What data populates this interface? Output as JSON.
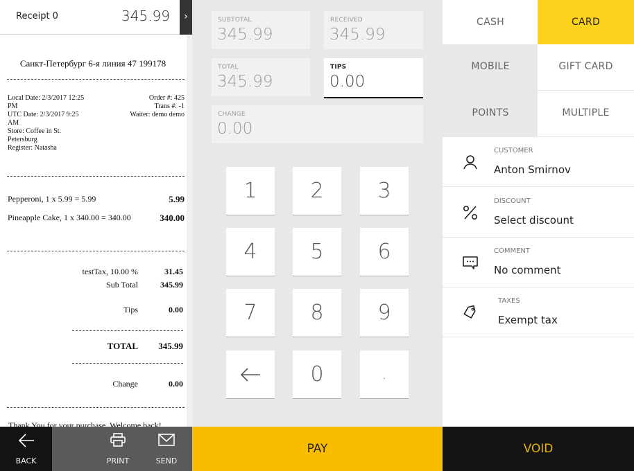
{
  "receipt_header": {
    "label": "Receipt  0",
    "amount": "345.99",
    "expand_icon": "chevron-right"
  },
  "receipt": {
    "store_address": "Санкт-Петербург 6-я линия 47 199178",
    "meta_left": [
      "Local Date: 2/3/2017 12:25",
      "PM",
      "UTC Date: 2/3/2017 9:25",
      "AM",
      "Store: Coffee in St.",
      "Petersburg",
      "Register: Natasha"
    ],
    "meta_right": [
      "Order #: 425",
      "Trans #: -1",
      "Waiter: demo demo"
    ],
    "items": [
      {
        "name": "Pepperoni, 1 x 5.99 = 5.99",
        "amount": "5.99"
      },
      {
        "name": "Pineapple Cake, 1 x 340.00 = 340.00",
        "amount": "340.00"
      }
    ],
    "tax": {
      "label": "testTax, 10.00 %",
      "value": "31.45"
    },
    "subtotal": {
      "label": "Sub Total",
      "value": "345.99"
    },
    "tips": {
      "label": "Tips",
      "value": "0.00"
    },
    "total": {
      "label": "TOTAL",
      "value": "345.99"
    },
    "change": {
      "label": "Change",
      "value": "0.00"
    },
    "thanks": "Thank You for your purchase. Welcome back!"
  },
  "left_bar": {
    "back": "BACK",
    "print": "PRINT",
    "send": "SEND"
  },
  "fields": {
    "subtotal": {
      "label": "SUBTOTAL",
      "value": "345.99"
    },
    "received": {
      "label": "RECEIVED",
      "value": "345.99"
    },
    "total": {
      "label": "TOTAL",
      "value": "345.99"
    },
    "tips": {
      "label": "TIPS",
      "value": "0.00"
    },
    "change": {
      "label": "CHANGE",
      "value": "0.00"
    }
  },
  "keypad": [
    "1",
    "2",
    "3",
    "4",
    "5",
    "6",
    "7",
    "8",
    "9",
    "backspace",
    "0",
    "."
  ],
  "pay_label": "PAY",
  "void_label": "VOID",
  "payment_methods": [
    {
      "label": "CASH",
      "selected": false
    },
    {
      "label": "CARD",
      "selected": true
    },
    {
      "label": "MOBILE",
      "selected": false
    },
    {
      "label": "GIFT CARD",
      "selected": false
    },
    {
      "label": "POINTS",
      "selected": false
    },
    {
      "label": "MULTIPLE",
      "selected": false
    }
  ],
  "options": [
    {
      "caption": "CUSTOMER",
      "value": "Anton Smirnov",
      "icon": "person-icon"
    },
    {
      "caption": "DISCOUNT",
      "value": "Select discount",
      "icon": "percent-icon"
    },
    {
      "caption": "COMMENT",
      "value": "No comment",
      "icon": "comment-icon"
    },
    {
      "caption": "TAXES",
      "value": "Exempt tax",
      "icon": "tag-icon"
    }
  ],
  "colors": {
    "accent_yellow": "#f9bd00",
    "selected_method": "#fcd21c",
    "void_text": "#e8b400",
    "dark": "#141414"
  }
}
